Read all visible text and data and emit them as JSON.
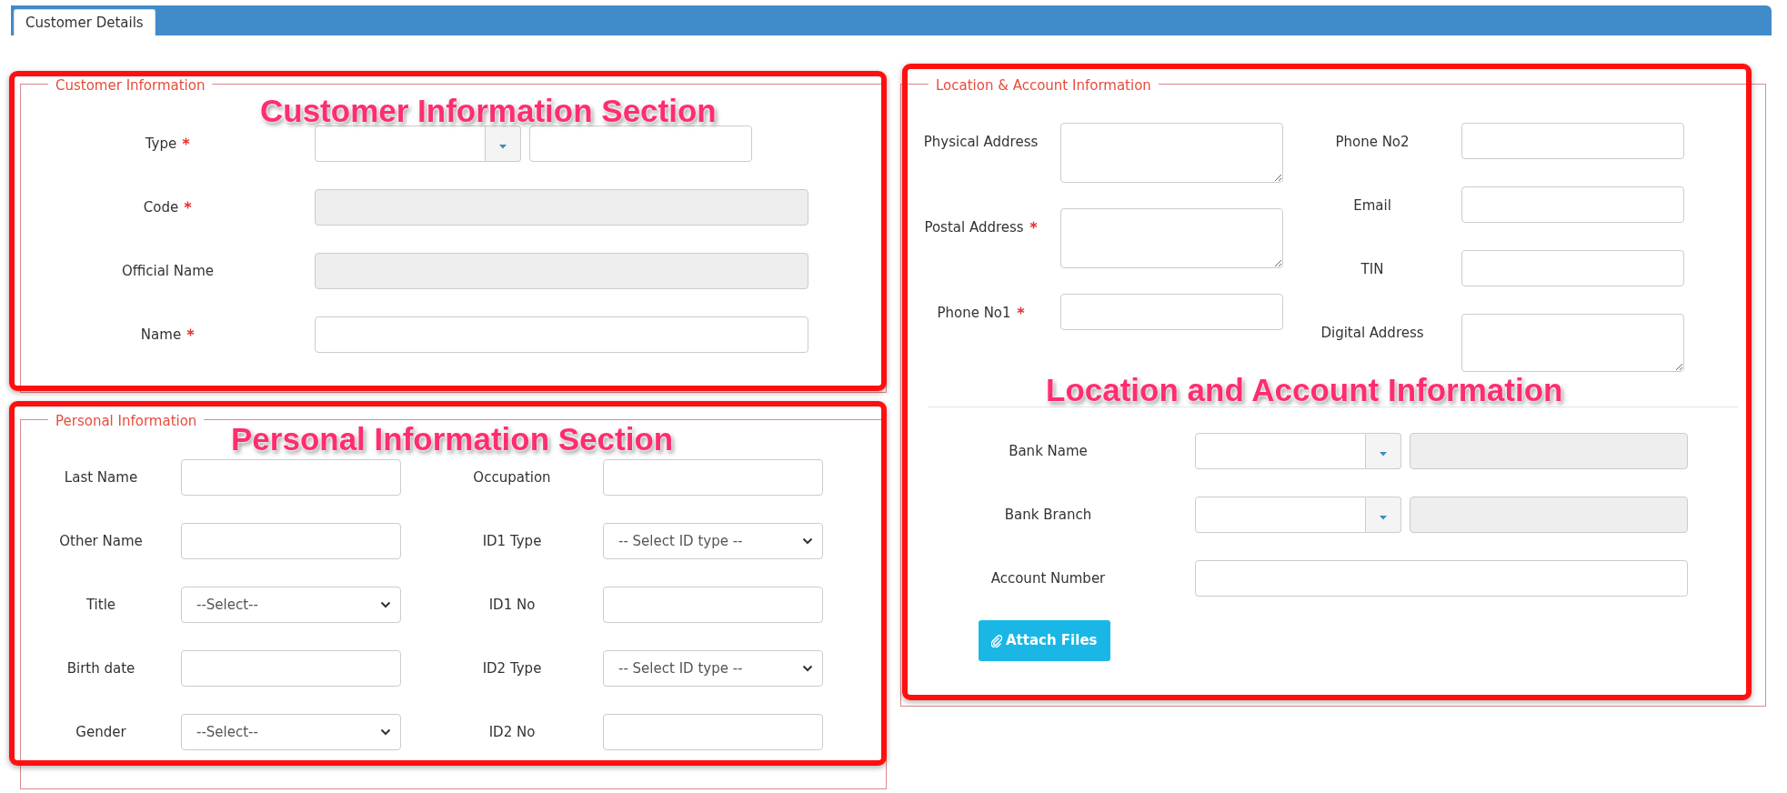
{
  "tabs": [
    {
      "label": "Customer Details",
      "selected": true
    }
  ],
  "customer_information": {
    "legend": "Customer Information",
    "fields": [
      {
        "label": "Type",
        "required": true,
        "kind": "combo_text"
      },
      {
        "label": "Code",
        "required": true,
        "kind": "readonly"
      },
      {
        "label": "Official Name",
        "required": false,
        "kind": "readonly"
      },
      {
        "label": "Name",
        "required": true,
        "kind": "text"
      }
    ]
  },
  "personal_information": {
    "legend": "Personal Information",
    "rows": [
      [
        {
          "label": "Last Name",
          "kind": "text"
        },
        {
          "label": "Occupation",
          "kind": "text"
        }
      ],
      [
        {
          "label": "Other Name",
          "kind": "text"
        },
        {
          "label": "ID1 Type",
          "kind": "select",
          "value": "-- Select ID type --"
        }
      ],
      [
        {
          "label": "Title",
          "kind": "select",
          "value": "--Select--"
        },
        {
          "label": "ID1 No",
          "kind": "text"
        }
      ],
      [
        {
          "label": "Birth date",
          "kind": "text"
        },
        {
          "label": "ID2 Type",
          "kind": "select",
          "value": "-- Select ID type --"
        }
      ],
      [
        {
          "label": "Gender",
          "kind": "select",
          "value": "--Select--"
        },
        {
          "label": "ID2 No",
          "kind": "text"
        }
      ]
    ]
  },
  "location_account": {
    "legend": "Location & Account Information",
    "left_fields": [
      {
        "label": "Physical Address",
        "required": false,
        "kind": "textarea"
      },
      {
        "label": "Postal Address",
        "required": true,
        "kind": "textarea"
      },
      {
        "label": "Phone No1",
        "required": true,
        "kind": "text"
      }
    ],
    "right_fields": [
      {
        "label": "Phone No2",
        "required": false,
        "kind": "text"
      },
      {
        "label": "Email",
        "required": false,
        "kind": "text"
      },
      {
        "label": "TIN",
        "required": false,
        "kind": "text"
      },
      {
        "label": "Digital Address",
        "required": false,
        "kind": "textarea"
      }
    ],
    "bank_fields": [
      {
        "label": "Bank Name",
        "kind": "combo"
      },
      {
        "label": "Bank Branch",
        "kind": "combo"
      },
      {
        "label": "Account Number",
        "kind": "text"
      }
    ],
    "attach_button": "Attach Files"
  },
  "annotations": [
    {
      "label": "Customer Information Section"
    },
    {
      "label": "Personal Information Section"
    },
    {
      "label": "Location and Account Information"
    }
  ]
}
